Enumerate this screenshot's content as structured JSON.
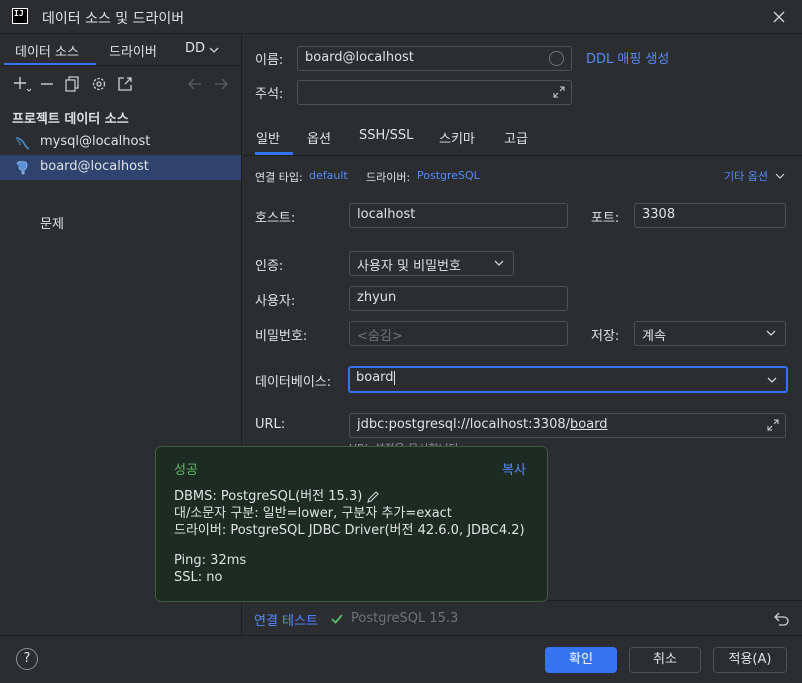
{
  "window": {
    "icon_text": "IJ",
    "title": "데이터 소스 및 드라이버"
  },
  "left": {
    "tabs": [
      "데이터 소스",
      "드라이버",
      "DD"
    ],
    "section_title": "프로젝트 데이터 소스",
    "datasources": [
      {
        "label": "mysql@localhost",
        "icon": "mysql-dolphin-icon"
      },
      {
        "label": "board@localhost",
        "icon": "postgresql-elephant-icon",
        "selected": true
      }
    ],
    "problems": "문제"
  },
  "form": {
    "name_label": "이름:",
    "name_value": "board@localhost",
    "ddl_link": "DDL 매핑 생성",
    "comment_label": "주석:",
    "tabs": [
      "일반",
      "옵션",
      "SSH/SSL",
      "스키마",
      "고급"
    ],
    "conn_type_label": "연결 타입:",
    "conn_type_value": "default",
    "driver_label": "드라이버:",
    "driver_value": "PostgreSQL",
    "other_options": "기타 옵션",
    "host_label": "호스트:",
    "host_value": "localhost",
    "port_label": "포트:",
    "port_value": "3308",
    "auth_label": "인증:",
    "auth_value": "사용자 및 비밀번호",
    "user_label": "사용자:",
    "user_value": "zhyun",
    "password_label": "비밀번호:",
    "password_placeholder": "<숨김>",
    "save_label": "저장:",
    "save_value": "계속",
    "database_label": "데이터베이스:",
    "database_value": "board",
    "url_label": "URL:",
    "url_prefix": "jdbc:postgresql://localhost:3308/",
    "url_db": "board",
    "url_hint": "URL 설정을 무시합니다"
  },
  "popup": {
    "title": "성공",
    "copy": "복사",
    "lines": [
      "DBMS: PostgreSQL(버전 15.3)",
      "대/소문자 구분: 일반=lower, 구분자 추가=exact",
      "드라이버: PostgreSQL JDBC Driver(버전 42.6.0, JDBC4.2)",
      "Ping: 32ms",
      "SSL: no"
    ]
  },
  "test": {
    "link": "연결 테스트",
    "status": "PostgreSQL 15.3"
  },
  "buttons": {
    "help": "?",
    "ok": "확인",
    "cancel": "취소",
    "apply": "적용(A)"
  },
  "colors": {
    "accent": "#3574f0",
    "link": "#548af7",
    "success": "#5fb865",
    "selection": "#2e436e"
  }
}
